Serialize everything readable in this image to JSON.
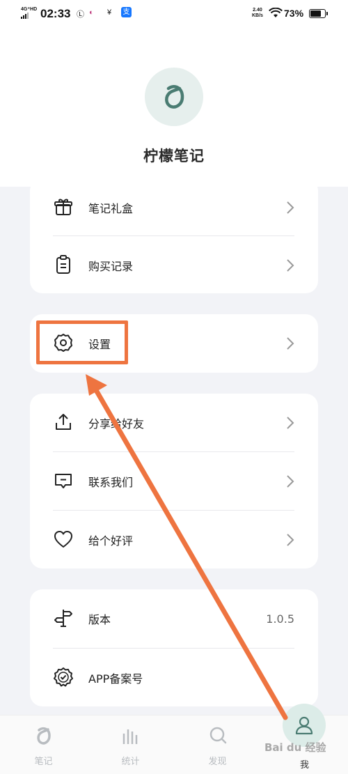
{
  "status_bar": {
    "network": "4G⁺HD",
    "time": "02:33",
    "speed_top": "2.40",
    "speed_unit": "KB/s",
    "battery": "73%"
  },
  "app": {
    "name": "柠檬笔记"
  },
  "menu": {
    "gift_box": "笔记礼盒",
    "purchase_history": "购买记录",
    "settings": "设置",
    "share": "分享给好友",
    "contact": "联系我们",
    "rate": "给个好评",
    "version_label": "版本",
    "version_value": "1.0.5",
    "record": "APP备案号"
  },
  "tabs": {
    "notes": "笔记",
    "stats": "统计",
    "discover": "发现",
    "me": "我"
  },
  "watermark": "Bai du 经验",
  "colors": {
    "accent": "#4a7c72",
    "highlight": "#ee7440"
  }
}
